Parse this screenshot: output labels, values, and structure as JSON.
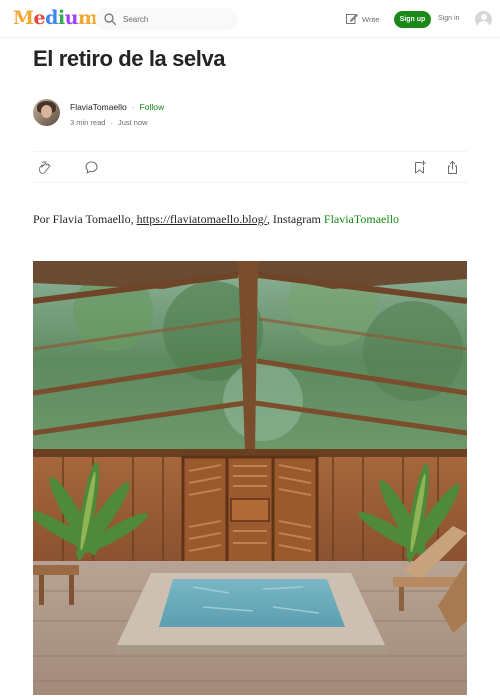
{
  "nav": {
    "logo_letters": [
      "M",
      "e",
      "d",
      "i",
      "u",
      "m"
    ],
    "search_placeholder": "Search",
    "write_label": "Write",
    "signup_label": "Sign up",
    "signin_label": "Sign in",
    "colors": {
      "logo": [
        "#f0a830",
        "#e0483b",
        "#4285f4",
        "#34a853",
        "#a142f4",
        "#f0a830"
      ],
      "signup_bg": "#1a8917"
    }
  },
  "article": {
    "title": "El retiro de la selva",
    "author": "FlaviaTomaello",
    "separator": "·",
    "follow_label": "Follow",
    "read_time": "3 min read",
    "published": "Just now",
    "byline": {
      "prefix": "Por Flavia Tomaello, ",
      "url_text": "https://flaviatomaello.blog/",
      "middle": ", Instagram ",
      "instagram_text": "FlaviaTomaello"
    },
    "icons": [
      "clap-icon",
      "comment-icon",
      "bookmark-add-icon",
      "share-icon"
    ],
    "hero_image_alt": "Open-air wooden pavilion with a small plunge pool, glass roof and tropical plants"
  }
}
